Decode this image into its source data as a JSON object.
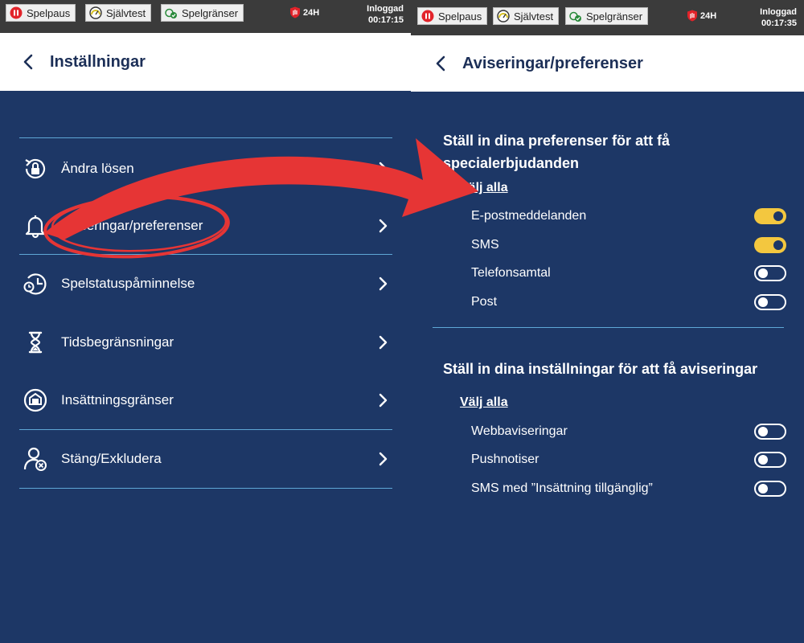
{
  "colors": {
    "topbar": "#3b3b3b",
    "content_bg": "#1d3766",
    "header_text": "#1c2f57",
    "divider": "#5fa7d6",
    "toggle_on": "#f3c73f",
    "annotation": "#e63535"
  },
  "left": {
    "topbar": {
      "pause_label": "Spelpaus",
      "selftest_label": "Självtest",
      "limits_label": "Spelgränser",
      "badge_label": "24H",
      "login_label": "Inloggad",
      "login_time": "00:17:15"
    },
    "header": {
      "title": "Inställningar"
    },
    "menu": [
      {
        "label": "Ändra lösen",
        "icon": "lock-reset-icon"
      },
      {
        "label": "Aviseringar/preferenser",
        "icon": "bell-icon"
      },
      {
        "label": "Spelstatuspåminnelse",
        "icon": "clock-reminder-icon"
      },
      {
        "label": "Tidsbegränsningar",
        "icon": "hourglass-icon"
      },
      {
        "label": "Insättningsgränser",
        "icon": "deposit-limit-icon"
      },
      {
        "label": "Stäng/Exkludera",
        "icon": "user-exclude-icon"
      }
    ]
  },
  "right": {
    "topbar": {
      "pause_label": "Spelpaus",
      "selftest_label": "Självtest",
      "limits_label": "Spelgränser",
      "badge_label": "24H",
      "login_label": "Inloggad",
      "login_time": "00:17:35"
    },
    "header": {
      "title": "Aviseringar/preferenser"
    },
    "offers": {
      "title": "Ställ in dina preferenser för att få specialerbjudanden",
      "select_all": "Välj alla",
      "items": [
        {
          "label": "E-postmeddelanden",
          "on": true
        },
        {
          "label": "SMS",
          "on": true
        },
        {
          "label": "Telefonsamtal",
          "on": false
        },
        {
          "label": "Post",
          "on": false
        }
      ]
    },
    "notifications": {
      "title": "Ställ in dina inställningar för att få aviseringar",
      "select_all": "Välj alla",
      "items": [
        {
          "label": "Webbaviseringar",
          "on": false
        },
        {
          "label": "Pushnotiser",
          "on": false
        },
        {
          "label": "SMS med ”Insättning tillgänglig”",
          "on": false
        }
      ]
    }
  }
}
